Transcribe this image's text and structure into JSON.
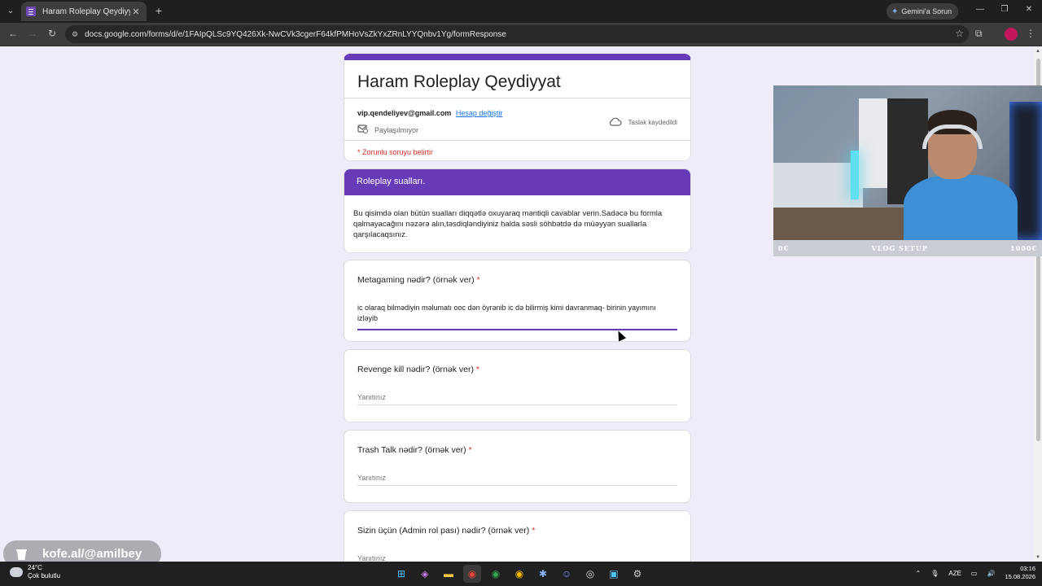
{
  "browser": {
    "tab_title": "Haram Roleplay Qeydiyyat",
    "url": "docs.google.com/forms/d/e/1FAIpQLSc9YQ426Xk-NwCVk3cgerF64kfPMHoVsZkYxZRnLYYQnbv1Yg/formResponse",
    "gemini_label": "Gemini'a Sorun"
  },
  "form": {
    "title": "Haram Roleplay Qeydiyyat",
    "email": "vip.qendeliyev@gmail.com",
    "switch_account": "Hesap değiştir",
    "not_shared": "Paylaşılmıyor",
    "draft_saved": "Taslak kaydedildi",
    "required_note": "* Zorunlu soruyu belirtir",
    "section_title": "Roleplay sualları.",
    "section_description": "Bu qisimdə olan bütün sualları diqqətlə oxuyaraq məntiqli cavablar verin.Sadəcə bu formla qalmayacağını nəzərə alın,təsdiqləndiyiniz halda səsli söhbətdə də müəyyən suallarla qarşılacaqsınız.",
    "questions": [
      {
        "title": "Metagaming nədir? (örnək ver)",
        "required_mark": "*",
        "answer": "ic olaraq bilmədiyin məlumatı ooc dən öyrənib ic də bilirmiş kimi davranmaq- birinin yayımını izləyib"
      },
      {
        "title": "Revenge kill nədir?  (örnək ver)",
        "required_mark": "*",
        "placeholder": "Yanıtınız"
      },
      {
        "title": "Trash Talk nədir?  (örnək ver)",
        "required_mark": "*",
        "placeholder": "Yanıtınız"
      },
      {
        "title": "Sizin üçün (Admin rol pası) nədir?  (örnək ver)",
        "required_mark": "*",
        "placeholder": "Yanıtınız"
      }
    ]
  },
  "webcam": {
    "bar_left": "0€",
    "bar_center": "VLOG SETUP",
    "bar_right": "1000€"
  },
  "watermark": "kofe.al/@amilbey",
  "taskbar": {
    "temperature": "24°C",
    "weather": "Çok bulutlu",
    "language": "AZE",
    "time": "03:16",
    "date": "15.08.2026"
  },
  "colors": {
    "accent": "#673ab7",
    "required": "#d93025",
    "link": "#1a73e8"
  }
}
